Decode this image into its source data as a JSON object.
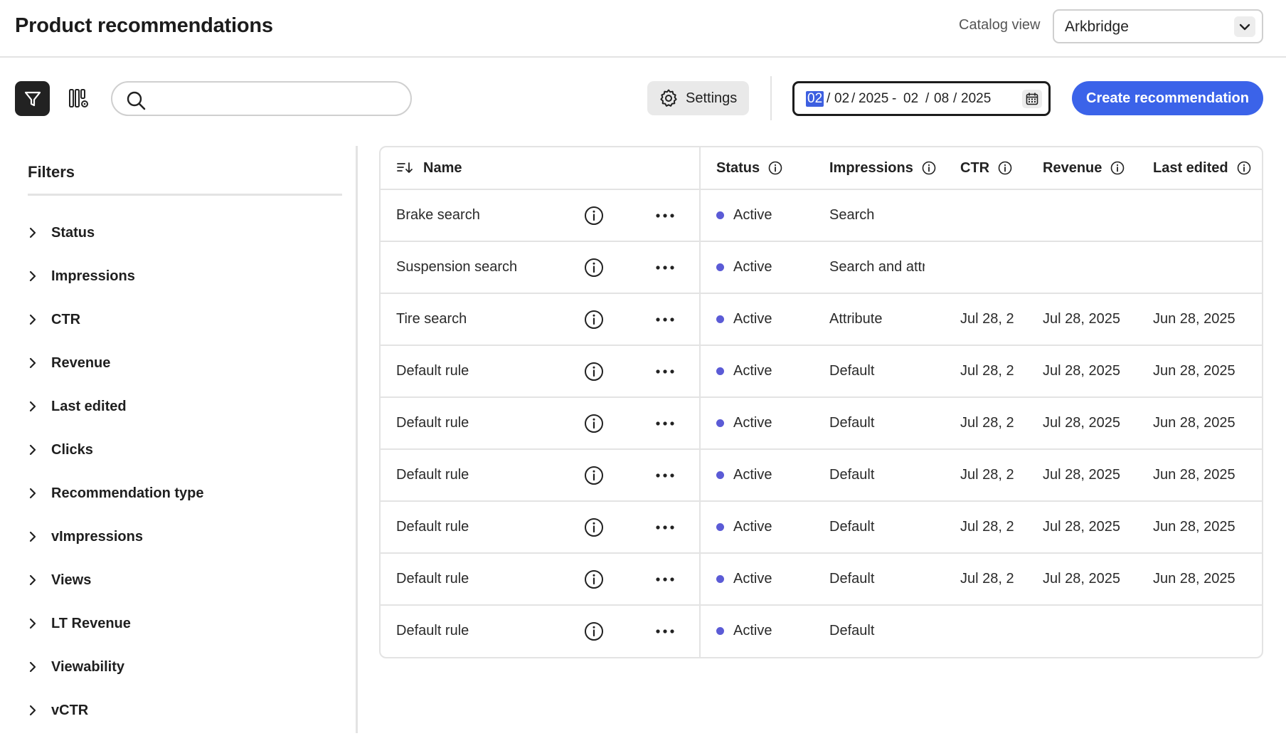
{
  "header": {
    "title": "Product recommendations",
    "catalog_label": "Catalog view",
    "catalog_value": "Arkbridge"
  },
  "toolbar": {
    "search_placeholder": "",
    "settings_label": "Settings",
    "date_range": {
      "start_month": "02",
      "start_day": "02",
      "start_year": "2025",
      "separator": "-",
      "end_month": "02",
      "end_day": "08",
      "end_year": "2025"
    },
    "create_label": "Create recommendation"
  },
  "filters": {
    "title": "Filters",
    "items": [
      "Status",
      "Impressions",
      "CTR",
      "Revenue",
      "Last edited",
      "Clicks",
      "Recommendation type",
      "vImpressions",
      "Views",
      "LT Revenue",
      "Viewability",
      "vCTR"
    ]
  },
  "table": {
    "columns": {
      "name": "Name",
      "status": "Status",
      "impressions": "Impressions",
      "ctr": "CTR",
      "revenue": "Revenue",
      "last_edited": "Last edited"
    },
    "status_color": "#5b5bd6",
    "rows": [
      {
        "name": "Brake search",
        "status": "Active",
        "impressions": "Search",
        "ctr": "",
        "revenue": "",
        "last_edited": ""
      },
      {
        "name": "Suspension search",
        "status": "Active",
        "impressions": "Search and attr",
        "ctr": "",
        "revenue": "",
        "last_edited": ""
      },
      {
        "name": "Tire search",
        "status": "Active",
        "impressions": "Attribute",
        "ctr": "Jul 28, 2",
        "revenue": "Jul 28, 2025",
        "last_edited": "Jun 28, 2025"
      },
      {
        "name": "Default rule",
        "status": "Active",
        "impressions": "Default",
        "ctr": "Jul 28, 2",
        "revenue": "Jul 28, 2025",
        "last_edited": "Jun 28, 2025"
      },
      {
        "name": "Default rule",
        "status": "Active",
        "impressions": "Default",
        "ctr": "Jul 28, 2",
        "revenue": "Jul 28, 2025",
        "last_edited": "Jun 28, 2025"
      },
      {
        "name": "Default rule",
        "status": "Active",
        "impressions": "Default",
        "ctr": "Jul 28, 2",
        "revenue": "Jul 28, 2025",
        "last_edited": "Jun 28, 2025"
      },
      {
        "name": "Default rule",
        "status": "Active",
        "impressions": "Default",
        "ctr": "Jul 28, 2",
        "revenue": "Jul 28, 2025",
        "last_edited": "Jun 28, 2025"
      },
      {
        "name": "Default rule",
        "status": "Active",
        "impressions": "Default",
        "ctr": "Jul 28, 2",
        "revenue": "Jul 28, 2025",
        "last_edited": "Jun 28, 2025"
      },
      {
        "name": "Default rule",
        "status": "Active",
        "impressions": "Default",
        "ctr": "",
        "revenue": "",
        "last_edited": ""
      }
    ]
  },
  "colors": {
    "accent": "#3b63e9",
    "filter_button": "#222222",
    "border": "#e3e3e3"
  },
  "icons": {
    "filter": "funnel-icon",
    "columns": "column-settings-icon",
    "search": "search-icon",
    "settings": "gear-icon",
    "calendar": "calendar-icon",
    "sort": "sort-icon",
    "info": "info-icon",
    "more": "more-icon",
    "chevron": "chevron-right-icon"
  }
}
